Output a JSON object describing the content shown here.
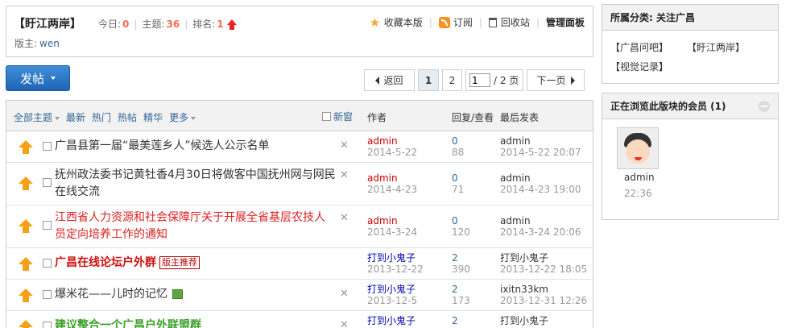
{
  "forum": {
    "title": "【盱江两岸】",
    "today_label": "今日:",
    "today_count": "0",
    "topics_label": "主题:",
    "topics_count": "36",
    "rank_label": "排名:",
    "rank_value": "1",
    "moderator_label": "版主:",
    "moderator_name": "wen",
    "links": {
      "favorite": "收藏本版",
      "subscribe": "订阅",
      "recycle": "回收站",
      "admin_panel": "管理面板"
    }
  },
  "toolbar": {
    "post_label": "发帖"
  },
  "pager": {
    "back": "返回",
    "pages": [
      "1",
      "2"
    ],
    "current_page": "1",
    "total_pages_text": "/ 2 页",
    "jump_value": "1",
    "next": "下一页"
  },
  "list_header": {
    "filters": [
      "全部主题",
      "最新",
      "热门",
      "热帖",
      "精华",
      "更多"
    ],
    "new_window": "新窗",
    "author": "作者",
    "replies_views": "回复/查看",
    "last_post": "最后发表"
  },
  "threads": [
    {
      "title": "广昌县第一届“最美莲乡人”候选人公示名单",
      "author": "admin",
      "date": "2014-5-22",
      "replies": "0",
      "views": "88",
      "last_user": "admin",
      "last_time": "2014-5-22 20:07"
    },
    {
      "title_line1": "抚州政法委书记黄牡香4月30日将做客中国抚州网与网民",
      "title_line2": "在线交流",
      "author": "admin",
      "date": "2014-4-23",
      "replies": "0",
      "views": "71",
      "last_user": "admin",
      "last_time": "2014-4-23 19:00"
    },
    {
      "title_line1": "江西省人力资源和社会保障厅关于开展全省基层农技人",
      "title_line2": "员定向培养工作的通知",
      "author": "admin",
      "date": "2014-3-24",
      "replies": "0",
      "views": "120",
      "last_user": "admin",
      "last_time": "2014-3-24 20:06"
    },
    {
      "title": "广昌在线论坛户外群",
      "tag": "版主推荐",
      "author": "打到小鬼子",
      "date": "2013-12-22",
      "replies": "2",
      "views": "390",
      "last_user": "打到小鬼子",
      "last_time": "2013-12-22 18:05"
    },
    {
      "title": "爆米花——儿时的记忆",
      "author": "打到小鬼子",
      "date": "2013-12-5",
      "replies": "2",
      "views": "173",
      "last_user": "ixitn33km",
      "last_time": "2013-12-31 12:26"
    },
    {
      "title": "建议整合一个广昌户外联盟群",
      "author": "打到小鬼子",
      "replies": "2",
      "last_user": "打到小鬼子"
    }
  ],
  "sidebar": {
    "category_title": "所属分类: 关注广昌",
    "categories": [
      "【广昌问吧】",
      "【盱江两岸】",
      "【视觉记录】"
    ],
    "online_title": "正在浏览此版块的会员 (1)",
    "online_user": "admin",
    "online_time": "22:36"
  },
  "colors": {
    "accent_blue": "#1f64b5",
    "count_orange": "#f26c4f",
    "hot_red": "#d22",
    "top_icon_orange": "#f5a015"
  }
}
